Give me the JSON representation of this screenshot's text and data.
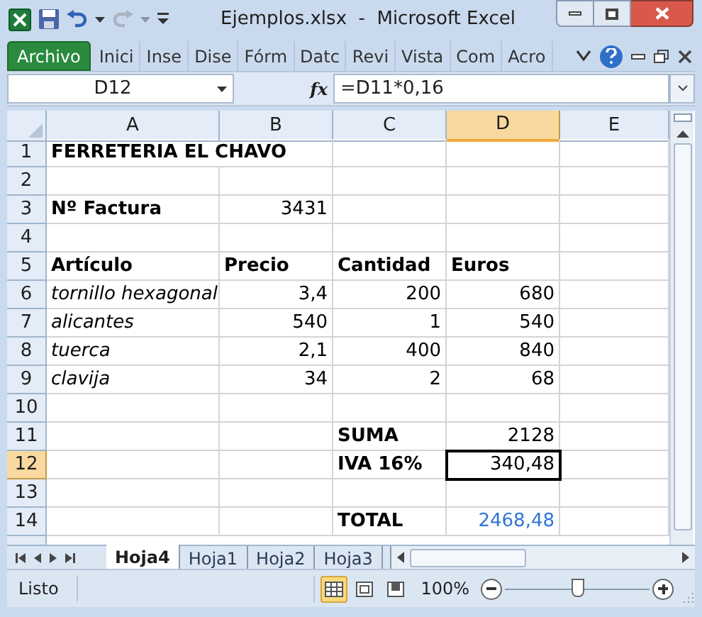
{
  "window": {
    "title": "Ejemplos.xlsx  -  Microsoft Excel"
  },
  "ribbon_tabs": [
    {
      "label": "Archivo",
      "selected": true
    },
    {
      "label": "Inici",
      "selected": false
    },
    {
      "label": "Inse",
      "selected": false
    },
    {
      "label": "Dise",
      "selected": false
    },
    {
      "label": "Fórm",
      "selected": false
    },
    {
      "label": "Datc",
      "selected": false
    },
    {
      "label": "Revi",
      "selected": false
    },
    {
      "label": "Vista",
      "selected": false
    },
    {
      "label": "Com",
      "selected": false
    },
    {
      "label": "Acro",
      "selected": false
    }
  ],
  "formula_bar": {
    "name_box": "D12",
    "fx": "fx",
    "formula": "=D11*0,16"
  },
  "columns": [
    {
      "label": "A",
      "selected": false
    },
    {
      "label": "B",
      "selected": false
    },
    {
      "label": "C",
      "selected": false
    },
    {
      "label": "D",
      "selected": true
    },
    {
      "label": "E",
      "selected": false
    }
  ],
  "rows": [
    {
      "header": "1",
      "selected": false,
      "cells": [
        {
          "text": "FERRETERIA EL CHAVO",
          "kind": "bold"
        },
        null,
        null,
        null,
        null
      ]
    },
    {
      "header": "2",
      "selected": false,
      "cells": [
        null,
        null,
        null,
        null,
        null
      ]
    },
    {
      "header": "3",
      "selected": false,
      "cells": [
        {
          "text": "Nº Factura",
          "kind": "bold"
        },
        {
          "text": "3431",
          "kind": "number"
        },
        null,
        null,
        null
      ]
    },
    {
      "header": "4",
      "selected": false,
      "cells": [
        null,
        null,
        null,
        null,
        null
      ]
    },
    {
      "header": "5",
      "selected": false,
      "cells": [
        {
          "text": "Artículo",
          "kind": "bold"
        },
        {
          "text": "Precio",
          "kind": "bold"
        },
        {
          "text": "Cantidad",
          "kind": "bold"
        },
        {
          "text": "Euros",
          "kind": "bold"
        },
        null
      ]
    },
    {
      "header": "6",
      "selected": false,
      "cells": [
        {
          "text": "tornillo hexagonal",
          "kind": "italic"
        },
        {
          "text": "3,4",
          "kind": "number"
        },
        {
          "text": "200",
          "kind": "number"
        },
        {
          "text": "680",
          "kind": "number"
        },
        null
      ]
    },
    {
      "header": "7",
      "selected": false,
      "cells": [
        {
          "text": "alicantes",
          "kind": "italic"
        },
        {
          "text": "540",
          "kind": "number"
        },
        {
          "text": "1",
          "kind": "number"
        },
        {
          "text": "540",
          "kind": "number"
        },
        null
      ]
    },
    {
      "header": "8",
      "selected": false,
      "cells": [
        {
          "text": "tuerca",
          "kind": "italic"
        },
        {
          "text": "2,1",
          "kind": "number"
        },
        {
          "text": "400",
          "kind": "number"
        },
        {
          "text": "840",
          "kind": "number"
        },
        null
      ]
    },
    {
      "header": "9",
      "selected": false,
      "cells": [
        {
          "text": "clavija",
          "kind": "italic"
        },
        {
          "text": "34",
          "kind": "number"
        },
        {
          "text": "2",
          "kind": "number"
        },
        {
          "text": "68",
          "kind": "number"
        },
        null
      ]
    },
    {
      "header": "10",
      "selected": false,
      "cells": [
        null,
        null,
        null,
        null,
        null
      ]
    },
    {
      "header": "11",
      "selected": false,
      "cells": [
        null,
        null,
        {
          "text": "SUMA",
          "kind": "bold"
        },
        {
          "text": "2128",
          "kind": "number"
        },
        null
      ]
    },
    {
      "header": "12",
      "selected": true,
      "cells": [
        null,
        null,
        {
          "text": "IVA 16%",
          "kind": "bold"
        },
        {
          "text": "340,48",
          "kind": "number"
        },
        null
      ]
    },
    {
      "header": "13",
      "selected": false,
      "cells": [
        null,
        null,
        null,
        null,
        null
      ]
    },
    {
      "header": "14",
      "selected": false,
      "cells": [
        null,
        null,
        {
          "text": "TOTAL",
          "kind": "bold"
        },
        {
          "text": "2468,48",
          "kind": "link"
        },
        null
      ]
    }
  ],
  "sheet_tabs": [
    {
      "label": "Hoja4",
      "selected": true
    },
    {
      "label": "Hoja1",
      "selected": false
    },
    {
      "label": "Hoja2",
      "selected": false
    },
    {
      "label": "Hoja3",
      "selected": false
    }
  ],
  "status_bar": {
    "status": "Listo",
    "views": [
      {
        "kind": "normal",
        "selected": true
      },
      {
        "kind": "layout",
        "selected": false
      },
      {
        "kind": "pagebreak",
        "selected": false
      }
    ],
    "zoom": "100%",
    "zoom_slider": {
      "level": 0.5
    }
  }
}
